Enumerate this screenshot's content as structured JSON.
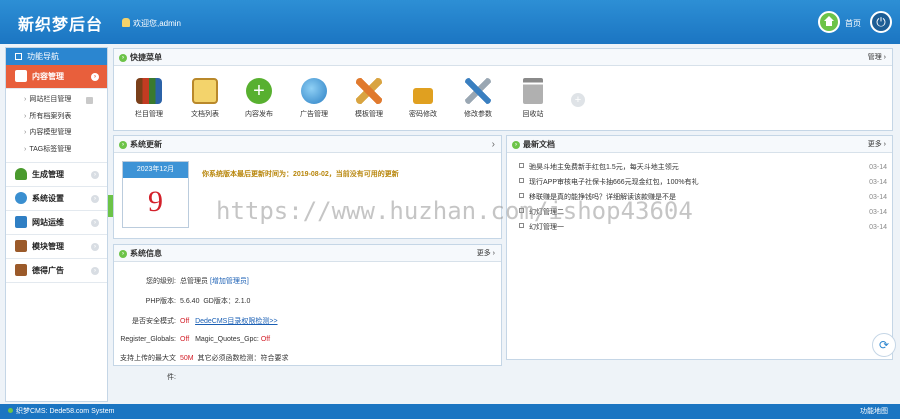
{
  "header": {
    "logo": "新织梦后台",
    "welcome": "欢迎您,admin",
    "home_label": "首页",
    "power_icon": "power-icon"
  },
  "sidebar": {
    "title": "功能导航",
    "groups": [
      {
        "label": "内容管理",
        "active": true,
        "icon": "edit-icon"
      },
      {
        "label": "生成管理",
        "icon": "tree-icon"
      },
      {
        "label": "系统设置",
        "icon": "settings-icon"
      },
      {
        "label": "网站运维",
        "icon": "monitor-icon"
      },
      {
        "label": "模块管理",
        "icon": "book-icon"
      },
      {
        "label": "德得广告",
        "icon": "book-icon"
      }
    ],
    "subitems": [
      "网站栏目管理",
      "所有档案列表",
      "内容模型管理",
      "TAG标签管理"
    ]
  },
  "quick_menu": {
    "title": "快捷菜单",
    "more": "管理 ›",
    "items": [
      {
        "label": "栏目管理",
        "icon": "books-icon",
        "color": "#8a5a2b"
      },
      {
        "label": "文档列表",
        "icon": "notepad-icon",
        "color": "#e9b949"
      },
      {
        "label": "内容发布",
        "icon": "plus-circle-icon",
        "color": "#58b030"
      },
      {
        "label": "广告管理",
        "icon": "globe-icon",
        "color": "#3a8fd0"
      },
      {
        "label": "模板管理",
        "icon": "pencil-ruler-icon",
        "color": "#e07a2e"
      },
      {
        "label": "密码修改",
        "icon": "lock-icon",
        "color": "#e0a020"
      },
      {
        "label": "修改参数",
        "icon": "tools-icon",
        "color": "#3a7fc0"
      },
      {
        "label": "回收站",
        "icon": "trash-icon",
        "color": "#777777"
      }
    ]
  },
  "update": {
    "title": "系统更新",
    "cal_month": "2023年12月",
    "cal_day": "9",
    "message": "你系统版本最后更新时间为：2019-08-02，当前没有可用的更新"
  },
  "info": {
    "title": "系统信息",
    "more": "更多 ›",
    "rows": [
      {
        "key": "您的级别:",
        "v1": "总管理员",
        "v2": "[增加管理员]"
      },
      {
        "key": "PHP版本:",
        "v1": "5.6.40",
        "v2": "GD版本：2.1.0"
      },
      {
        "key": "是否安全模式:",
        "v1": "Off",
        "v2": "DedeCMS目录权限检测>>"
      },
      {
        "key": "Register_Globals:",
        "v1": "Off",
        "v2": "Magic_Quotes_Gpc:",
        "v3": "Off"
      },
      {
        "key": "支持上传的最大文件:",
        "v1": "50M",
        "v2": "其它必须函数检测：符合要求"
      }
    ]
  },
  "docs": {
    "title": "最新文档",
    "more": "更多 ›",
    "items": [
      {
        "title": "驰昊斗地主免费新手红包1.5元，每天斗地主领元",
        "date": "03-14"
      },
      {
        "title": "现行APP审核电子社保卡抽666元现金红包，100%有礼",
        "date": "03-14"
      },
      {
        "title": "移联赚是真的能挣钱吗？详细解读该款赚是不是",
        "date": "03-14"
      },
      {
        "title": "幻灯管理二",
        "date": "03-14"
      },
      {
        "title": "幻灯管理一",
        "date": "03-14"
      }
    ]
  },
  "footer": {
    "left": "织梦CMS: Dede58.com System",
    "right": "功能地图"
  },
  "watermark": "https://www.huzhan.com/ishop43604"
}
